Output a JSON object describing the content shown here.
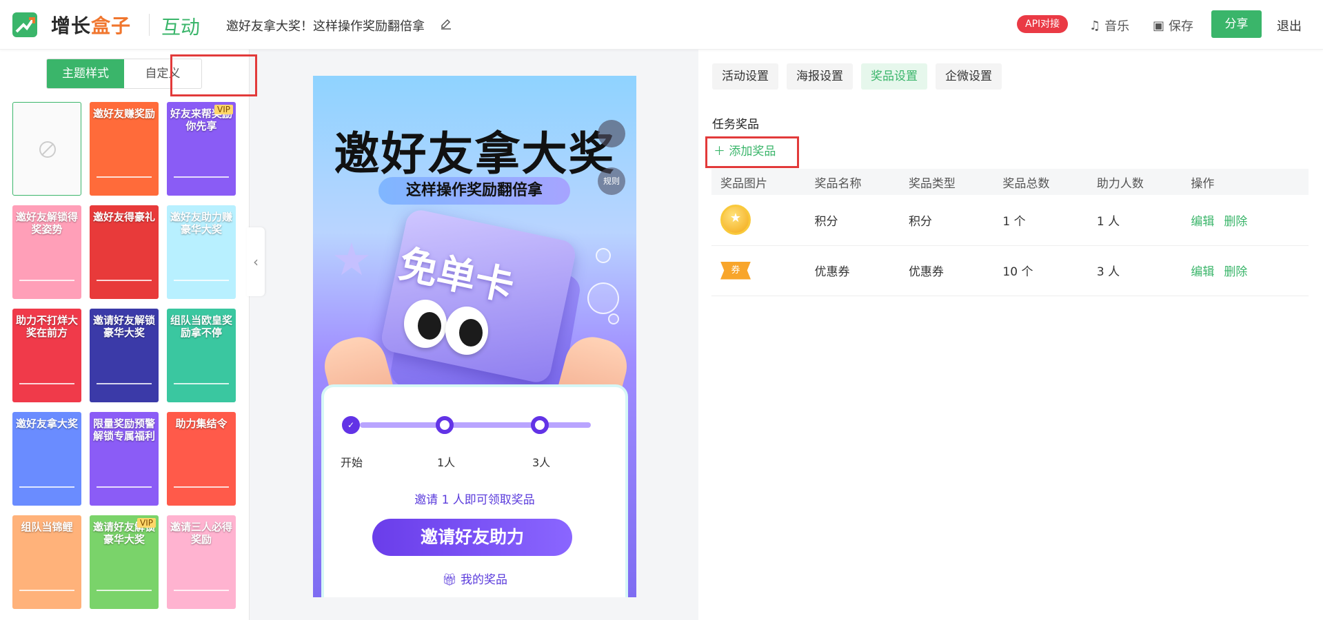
{
  "header": {
    "brand_part1": "增长",
    "brand_part2": "盒子",
    "mode": "互动",
    "title": "邀好友拿大奖！这样操作奖励翻倍拿",
    "api_badge": "API对接",
    "music": "音乐",
    "save": "保存",
    "share": "分享",
    "exit": "退出"
  },
  "left": {
    "seg_theme": "主题样式",
    "seg_custom": "自定义",
    "thumbs": [
      {
        "title": "",
        "bg": "#fafafa"
      },
      {
        "title": "邀好友赚奖励",
        "bg": "#ff6b3a"
      },
      {
        "title": "好友来帮奖励你先享",
        "bg": "#8a5cf5",
        "vip": "VIP"
      },
      {
        "title": "邀好友解锁得奖姿势",
        "bg": "#ff9fb8"
      },
      {
        "title": "邀好友得豪礼",
        "bg": "#e83a3a"
      },
      {
        "title": "邀好友助力赚豪华大奖",
        "bg": "#b8f0ff"
      },
      {
        "title": "助力不打烊大奖在前方",
        "bg": "#f03a4a"
      },
      {
        "title": "邀请好友解锁豪华大奖",
        "bg": "#3b3aa8"
      },
      {
        "title": "组队当欧皇奖励拿不停",
        "bg": "#3ac7a0"
      },
      {
        "title": "邀好友拿大奖",
        "bg": "#6a8cff"
      },
      {
        "title": "限量奖励预警解锁专属福利",
        "bg": "#8b5cf6"
      },
      {
        "title": "助力集结令",
        "bg": "#ff5a4a"
      },
      {
        "title": "组队当锦鲤",
        "bg": "#ffb27a"
      },
      {
        "title": "邀请好友解锁豪华大奖",
        "bg": "#7ad36a",
        "vip": "VIP"
      },
      {
        "title": "邀请三人必得奖励",
        "bg": "#ffb3d0"
      }
    ]
  },
  "canvas": {
    "title": "邀好友拿大奖",
    "subtitle": "这样操作奖励翻倍拿",
    "rule": "规则",
    "ticket_text": "免单卡",
    "steps": [
      "开始",
      "1人",
      "3人"
    ],
    "invite_tip": "邀请 1 人即可领取奖品",
    "invite_btn": "邀请好友助力",
    "my_prize": "我的奖品"
  },
  "right": {
    "tabs": [
      "活动设置",
      "海报设置",
      "奖品设置",
      "企微设置"
    ],
    "section_title": "任务奖品",
    "add_prize": "添加奖品",
    "columns": [
      "奖品图片",
      "奖品名称",
      "奖品类型",
      "奖品总数",
      "助力人数",
      "操作"
    ],
    "rows": [
      {
        "name": "积分",
        "type": "积分",
        "total": "1 个",
        "helpers": "1 人",
        "edit": "编辑",
        "del": "删除",
        "icon": "coin-icon"
      },
      {
        "name": "优惠券",
        "type": "优惠券",
        "total": "10 个",
        "helpers": "3 人",
        "edit": "编辑",
        "del": "删除",
        "icon": "coupon-icon",
        "icon_text": "券"
      }
    ]
  },
  "colors": {
    "accent": "#3ab56a",
    "highlight": "#e23a3a",
    "purple": "#6233e6"
  }
}
